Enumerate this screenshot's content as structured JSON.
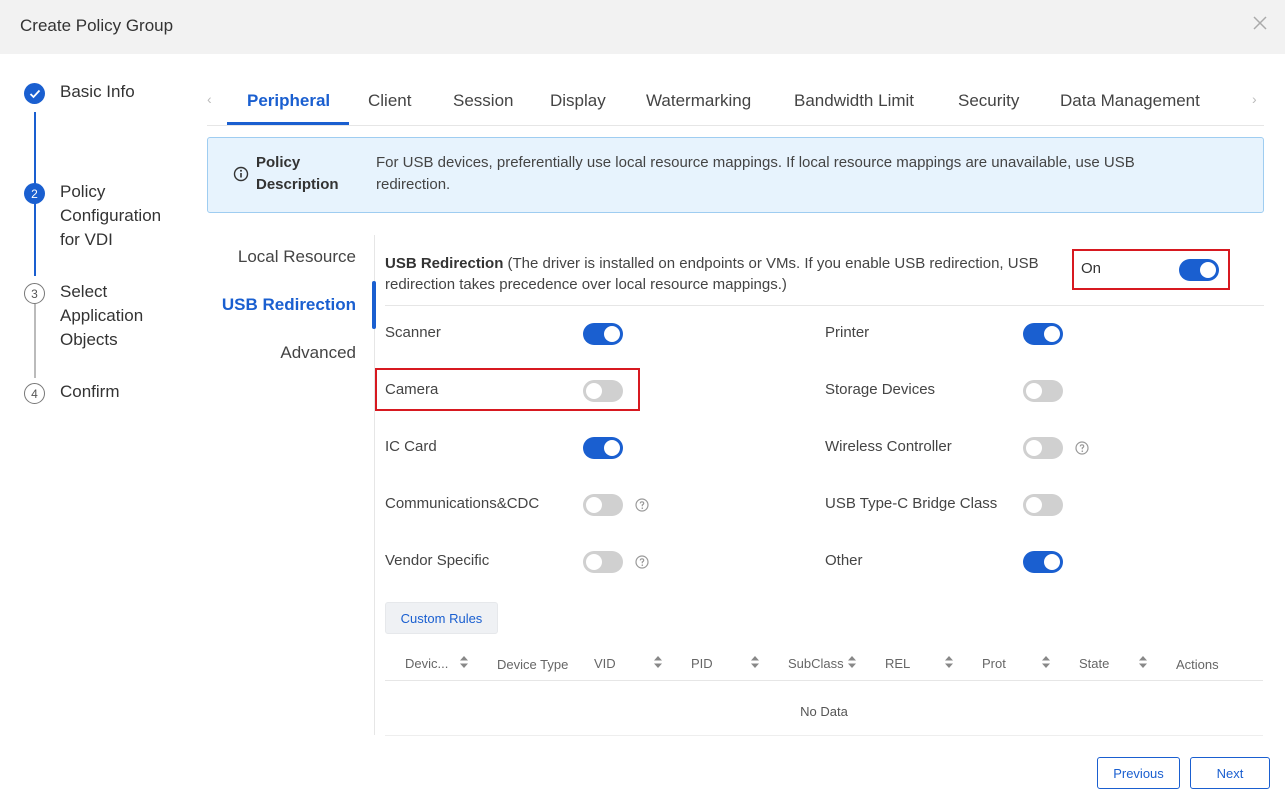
{
  "dialog": {
    "title": "Create Policy Group"
  },
  "steps": [
    {
      "label": "Basic Info",
      "number": ""
    },
    {
      "label": "Policy Configuration for VDI",
      "number": "2"
    },
    {
      "label": "Select Application Objects",
      "number": "3"
    },
    {
      "label": "Confirm",
      "number": "4"
    }
  ],
  "tabs": [
    "Peripheral",
    "Client",
    "Session",
    "Display",
    "Watermarking",
    "Bandwidth Limit",
    "Security",
    "Data Management"
  ],
  "policy": {
    "label": "Policy Description",
    "text": "For USB devices, preferentially use local resource mappings. If local resource mappings are unavailable, use USB redirection."
  },
  "subnav": [
    "Local Resource",
    "USB Redirection",
    "Advanced"
  ],
  "usb": {
    "title": "USB Redirection",
    "note": " (The driver is installed on endpoints or VMs. If you enable USB redirection, USB redirection takes precedence over local resource mappings.)",
    "status": "On",
    "enabled": true
  },
  "devices": [
    {
      "label": "Scanner",
      "on": true,
      "help": false
    },
    {
      "label": "Printer",
      "on": true,
      "help": false
    },
    {
      "label": "Camera",
      "on": false,
      "help": false
    },
    {
      "label": "Storage Devices",
      "on": false,
      "help": false
    },
    {
      "label": "IC Card",
      "on": true,
      "help": false
    },
    {
      "label": "Wireless Controller",
      "on": false,
      "help": true
    },
    {
      "label": "Communications&CDC",
      "on": false,
      "help": true
    },
    {
      "label": "USB Type-C Bridge Class",
      "on": false,
      "help": false
    },
    {
      "label": "Vendor Specific",
      "on": false,
      "help": true
    },
    {
      "label": "Other",
      "on": true,
      "help": false
    }
  ],
  "custom_rules": {
    "button_label": "Custom Rules",
    "columns": [
      "Devic...",
      "Device Type",
      "VID",
      "PID",
      "SubClass",
      "REL",
      "Prot",
      "State",
      "Actions"
    ],
    "empty_text": "No Data"
  },
  "footer": {
    "previous_label": "Previous",
    "next_label": "Next"
  },
  "colors": {
    "accent": "#1a5fd0",
    "highlight": "#d71920",
    "info_bg": "#e7f3fd"
  }
}
